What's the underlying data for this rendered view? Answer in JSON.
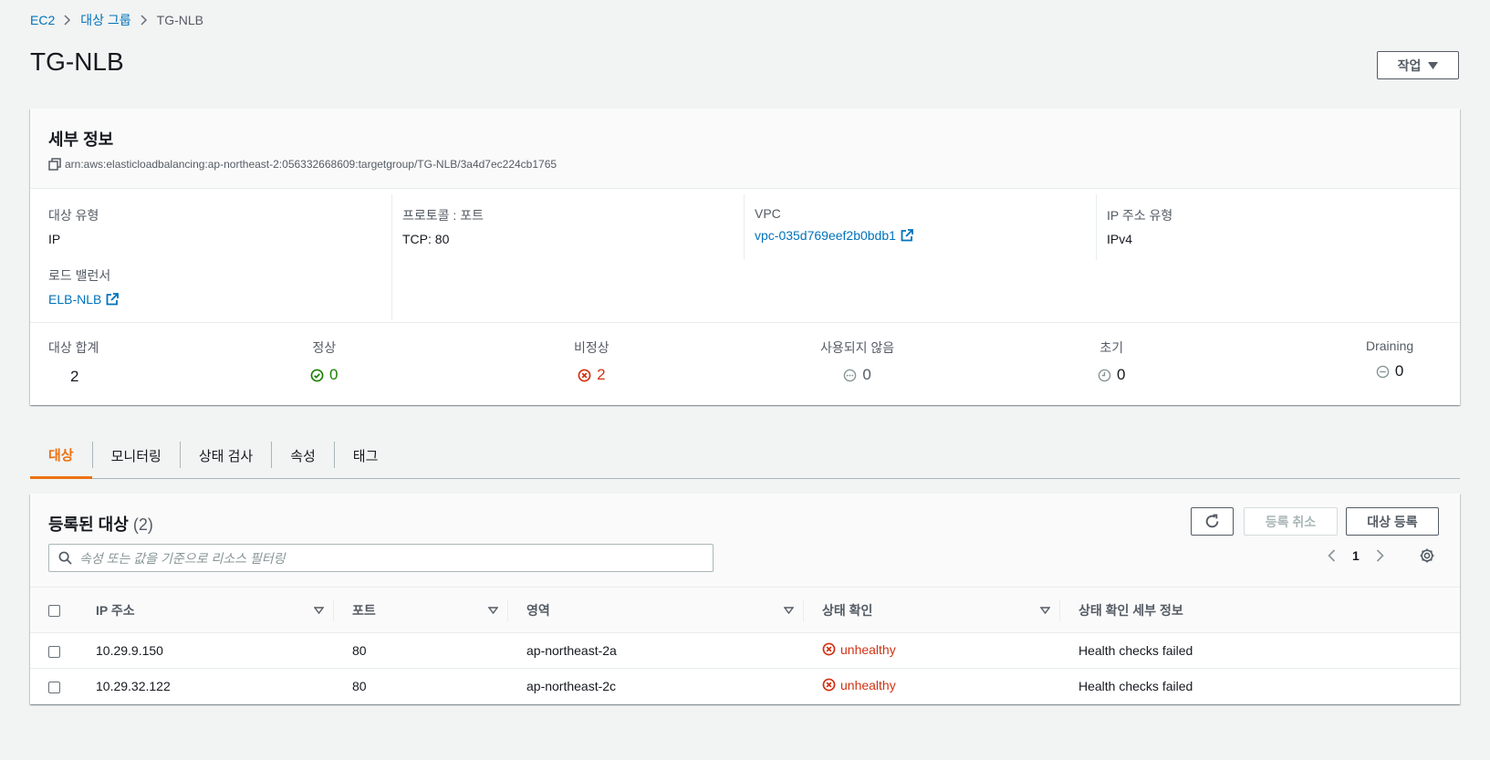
{
  "breadcrumb": {
    "items": [
      "EC2",
      "대상 그룹"
    ],
    "current": "TG-NLB"
  },
  "page": {
    "title": "TG-NLB",
    "action_label": "작업"
  },
  "details": {
    "title": "세부 정보",
    "arn": "arn:aws:elasticloadbalancing:ap-northeast-2:056332668609:targetgroup/TG-NLB/3a4d7ec224cb1765",
    "target_type_label": "대상 유형",
    "target_type_value": "IP",
    "load_balancer_label": "로드 밸런서",
    "load_balancer_value": "ELB-NLB",
    "protocol_label": "프로토콜 : 포트",
    "protocol_value": "TCP: 80",
    "vpc_label": "VPC",
    "vpc_value": "vpc-035d769eef2b0bdb1",
    "ip_type_label": "IP 주소 유형",
    "ip_type_value": "IPv4"
  },
  "stats": {
    "total_label": "대상 합계",
    "total_value": "2",
    "healthy_label": "정상",
    "healthy_value": "0",
    "unhealthy_label": "비정상",
    "unhealthy_value": "2",
    "unused_label": "사용되지 않음",
    "unused_value": "0",
    "initial_label": "초기",
    "initial_value": "0",
    "draining_label": "Draining",
    "draining_value": "0"
  },
  "tabs": [
    "대상",
    "모니터링",
    "상태 검사",
    "속성",
    "태그"
  ],
  "targets": {
    "title": "등록된 대상",
    "count": "(2)",
    "deregister_label": "등록 취소",
    "register_label": "대상 등록",
    "search_placeholder": "속성 또는 값을 기준으로 리소스 필터링",
    "page_number": "1",
    "columns": [
      "IP 주소",
      "포트",
      "영역",
      "상태 확인",
      "상태 확인 세부 정보"
    ],
    "rows": [
      {
        "ip": "10.29.9.150",
        "port": "80",
        "zone": "ap-northeast-2a",
        "status": "unhealthy",
        "detail": "Health checks failed"
      },
      {
        "ip": "10.29.32.122",
        "port": "80",
        "zone": "ap-northeast-2c",
        "status": "unhealthy",
        "detail": "Health checks failed"
      }
    ]
  },
  "colors": {
    "link": "#0073bb",
    "accent": "#ec7211",
    "ok": "#1d8102",
    "error": "#d13212"
  }
}
